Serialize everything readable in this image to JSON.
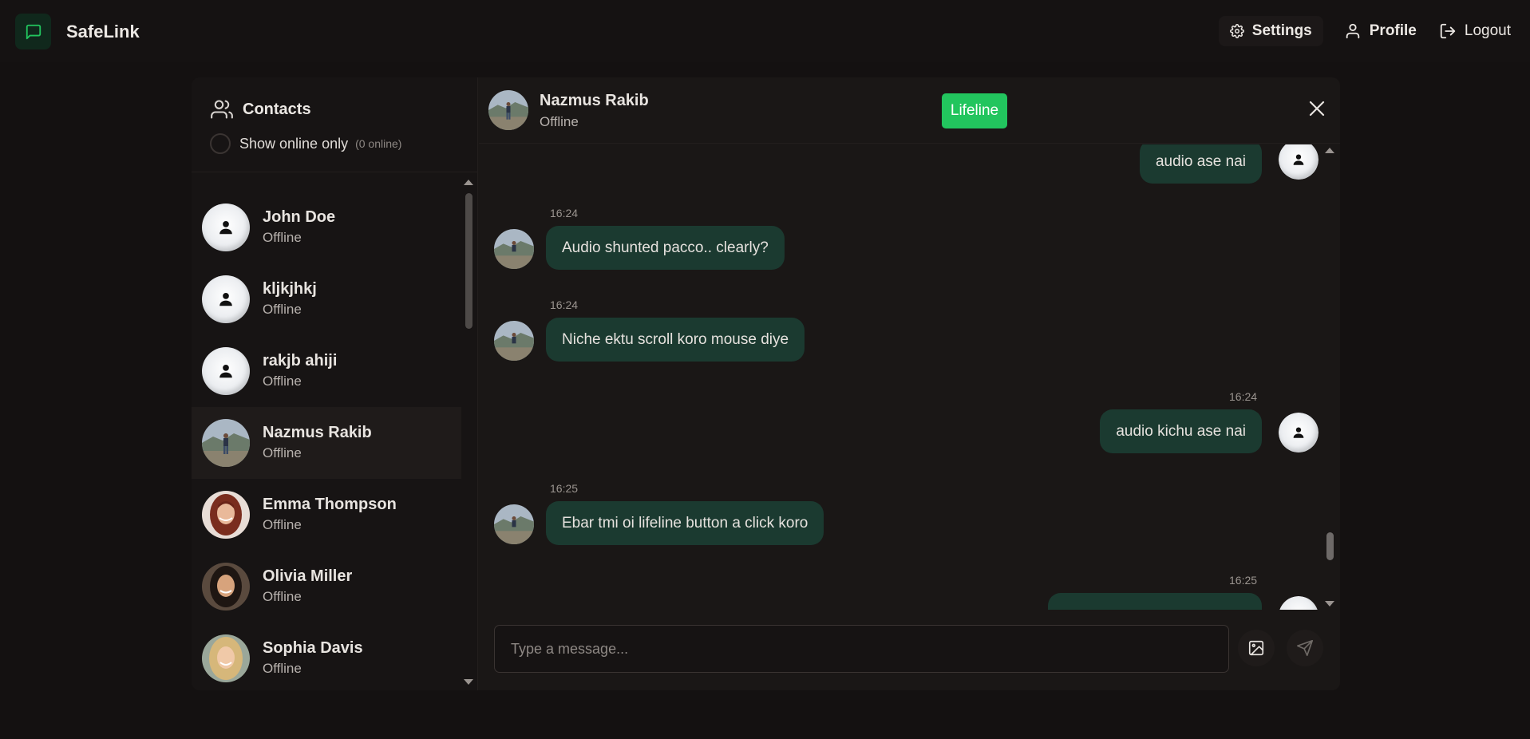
{
  "app": {
    "name": "SafeLink",
    "logo_icon": "chat-bubble-icon",
    "accent_color": "#22c55e"
  },
  "nav": {
    "settings_label": "Settings",
    "profile_label": "Profile",
    "logout_label": "Logout"
  },
  "sidebar": {
    "title": "Contacts",
    "online_only_label": "Show online only",
    "online_count": "(0 online)",
    "contacts": [
      {
        "name": "John Doe",
        "status": "Offline",
        "avatar": "default"
      },
      {
        "name": "kljkjhkj",
        "status": "Offline",
        "avatar": "default"
      },
      {
        "name": "rakjb ahiji",
        "status": "Offline",
        "avatar": "default"
      },
      {
        "name": "Nazmus Rakib",
        "status": "Offline",
        "avatar": "landscape",
        "active": true
      },
      {
        "name": "Emma Thompson",
        "status": "Offline",
        "avatar": "photo-woman-red"
      },
      {
        "name": "Olivia Miller",
        "status": "Offline",
        "avatar": "photo-woman-dark"
      },
      {
        "name": "Sophia Davis",
        "status": "Offline",
        "avatar": "photo-woman-blonde"
      }
    ]
  },
  "chat": {
    "name": "Nazmus Rakib",
    "status": "Offline",
    "lifeline_label": "Lifeline",
    "messages": [
      {
        "direction": "out",
        "time": "",
        "text": "audio ase nai"
      },
      {
        "direction": "in",
        "time": "16:24",
        "text": "Audio shunted pacco.. clearly?"
      },
      {
        "direction": "in",
        "time": "16:24",
        "text": "Niche ektu scroll koro mouse diye"
      },
      {
        "direction": "out",
        "time": "16:24",
        "text": "audio kichu ase nai"
      },
      {
        "direction": "in",
        "time": "16:25",
        "text": "Ebar tmi oi lifeline button a click koro"
      },
      {
        "direction": "out",
        "time": "16:25",
        "text": ""
      }
    ],
    "input_placeholder": "Type a message..."
  }
}
